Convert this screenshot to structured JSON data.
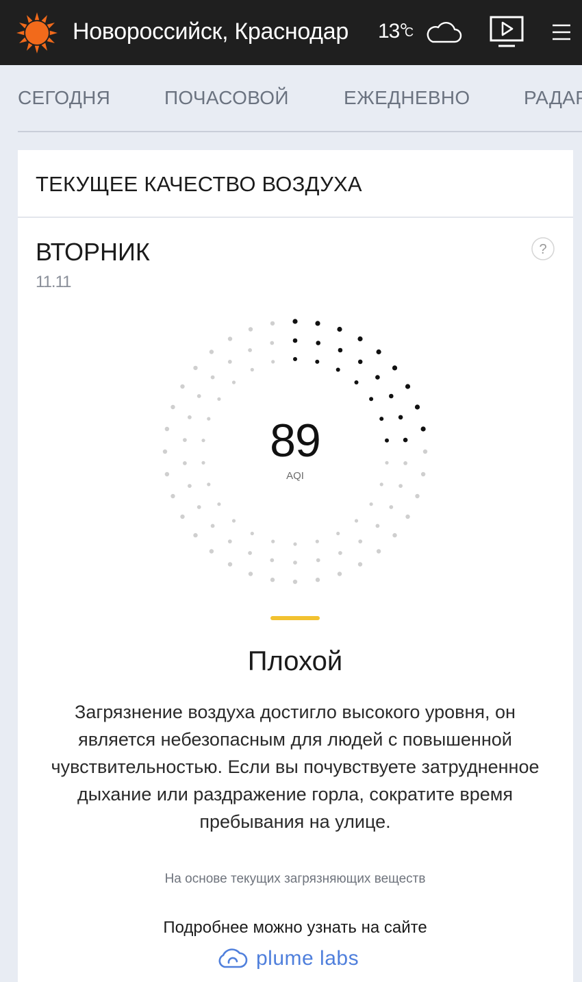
{
  "header": {
    "location": "Новороссийск, Краснодар",
    "temperature": "13°",
    "temperature_unit": "C",
    "weather_icon": "cloud-icon",
    "video_icon": "video-play-icon",
    "menu_icon": "menu-icon",
    "logo_icon": "sun-icon",
    "background_color": "#1f1f1f"
  },
  "tabs": [
    {
      "label": "СЕГОДНЯ"
    },
    {
      "label": "ПОЧАСОВОЙ"
    },
    {
      "label": "ЕЖЕДНЕВНО"
    },
    {
      "label": "РАДАР"
    }
  ],
  "air_quality": {
    "title": "ТЕКУЩЕЕ КАЧЕСТВО ВОЗДУХА",
    "day": "ВТОРНИК",
    "date": "11.11",
    "aqi": "89",
    "aqi_label": "AQI",
    "gauge_fill_fraction": 0.25,
    "level": "Плохой",
    "level_color": "#f2c230",
    "description": "Загрязнение воздуха достигло высокого уровня, он является небезопасным для людей с повышенной чувствительностью. Если вы почувствуете затрудненное дыхание или раздражение горла, сократите время пребывания на улице.",
    "basis_note": "На основе текущих загрязняющих веществ",
    "more_info": "Подробнее можно узнать на сайте",
    "partner": "plume labs"
  },
  "colors": {
    "accent_orange": "#f26a1b",
    "partner_blue": "#4f7fdc",
    "dot_active": "#111111",
    "dot_inactive": "#cfcfcf"
  }
}
